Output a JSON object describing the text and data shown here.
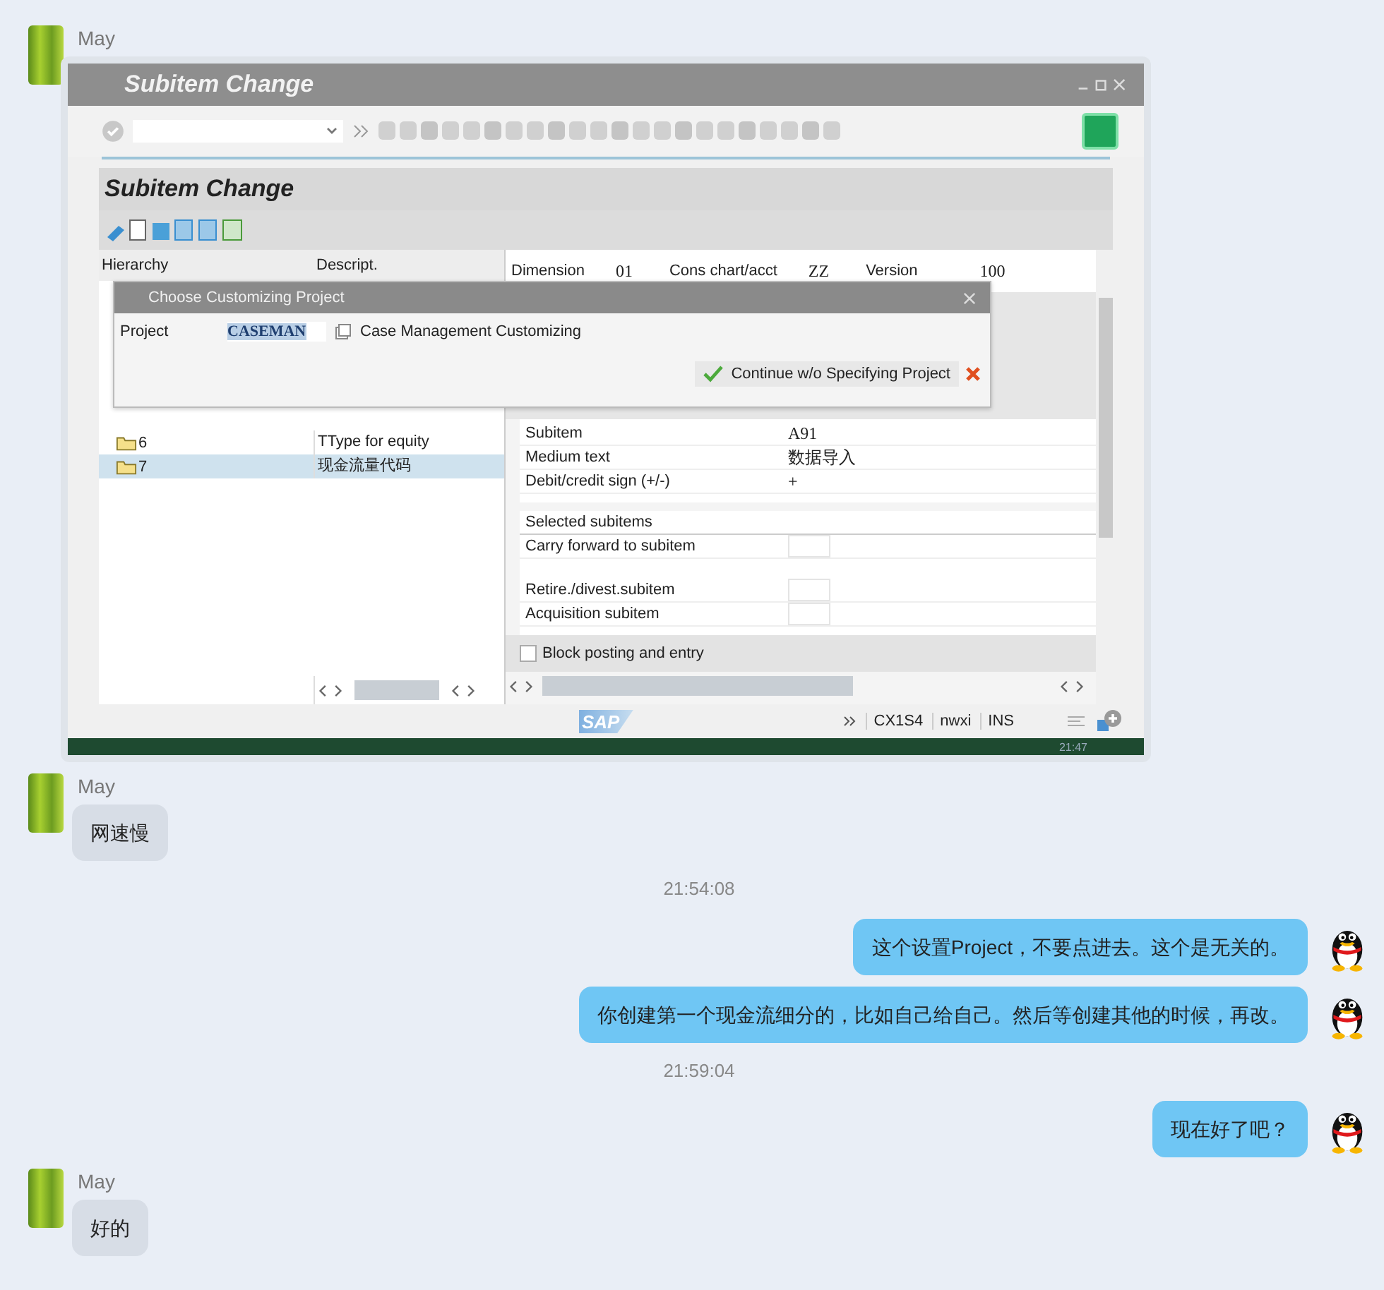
{
  "messages": [
    {
      "kind": "image",
      "sender": "May",
      "sap": {
        "window_title": "Subitem Change",
        "screen_title": "Subitem Change",
        "tree_columns": [
          "Hierarchy",
          "Descript."
        ],
        "tree_rows": [
          {
            "hierarchy": "6",
            "description": "TType for equity",
            "selected": false
          },
          {
            "hierarchy": "7",
            "description": "现金流量代码",
            "selected": true
          }
        ],
        "header_fields": [
          {
            "label": "Dimension",
            "value": "01"
          },
          {
            "label": "Cons chart/acct",
            "value": "ZZ"
          },
          {
            "label": "Version",
            "value": "100"
          }
        ],
        "detail_rows": [
          {
            "label": "Subitem",
            "value": "A91"
          },
          {
            "label": "Medium text",
            "value": "数据导入"
          },
          {
            "label": "Debit/credit sign (+/-)",
            "value": "+"
          }
        ],
        "subitems_title": "Selected subitems",
        "subitem_rows": [
          {
            "label": "Carry forward to subitem"
          },
          {
            "label": "Retire./divest.subitem"
          },
          {
            "label": "Acquisition subitem"
          }
        ],
        "block_checkbox": {
          "label": "Block posting and entry",
          "checked": false
        },
        "dialog": {
          "title": "Choose Customizing Project",
          "field_label": "Project",
          "field_value": "CASEMAN",
          "project_name": "Case Management Customizing",
          "button": "Continue w/o Specifying Project"
        },
        "logo": "SAP",
        "status": [
          "CX1S4",
          "nwxi",
          "INS"
        ],
        "taskbar_time": "21:47"
      }
    },
    {
      "kind": "incoming",
      "sender": "May",
      "text": "网速慢"
    },
    {
      "kind": "time",
      "text": "21:54:08"
    },
    {
      "kind": "outgoing",
      "text": "这个设置Project，不要点进去。这个是无关的。"
    },
    {
      "kind": "outgoing",
      "text": "你创建第一个现金流细分的，比如自己给自己。然后等创建其他的时候，再改。"
    },
    {
      "kind": "time",
      "text": "21:59:04"
    },
    {
      "kind": "outgoing",
      "text": "现在好了吧？"
    },
    {
      "kind": "incoming",
      "sender": "May",
      "text": "好的"
    }
  ]
}
